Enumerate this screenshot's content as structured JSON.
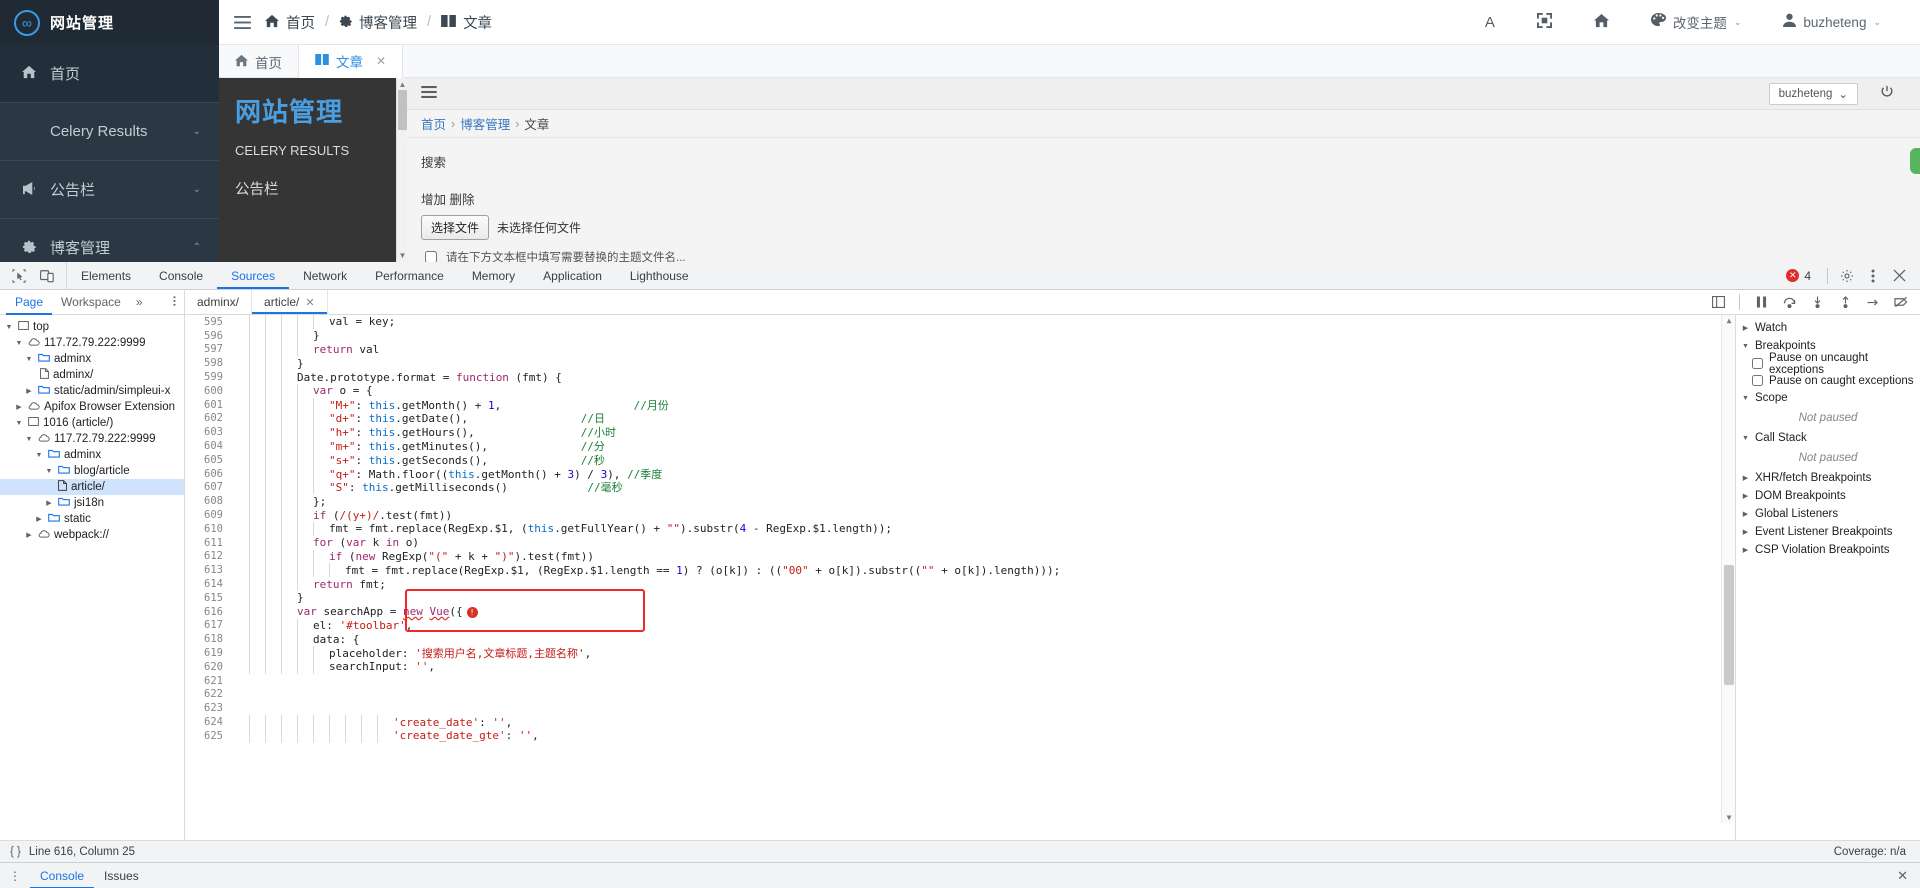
{
  "app": {
    "sidebar": {
      "logo_icon": "infinity-icon",
      "logo_text": "网站管理",
      "items": [
        {
          "icon": "home-icon",
          "label": "首页",
          "caret": "",
          "active": true
        },
        {
          "icon": "",
          "label": "Celery Results",
          "caret": "⌄",
          "active": false
        },
        {
          "icon": "megaphone-icon",
          "label": "公告栏",
          "caret": "⌄",
          "active": false
        },
        {
          "icon": "gear-icon",
          "label": "博客管理",
          "caret": "⌃",
          "active": false
        }
      ]
    },
    "header": {
      "hamburger_icon": "hamburger-icon",
      "breadcrumb": [
        {
          "icon": "home-icon",
          "label": "首页"
        },
        {
          "icon": "gear-icon",
          "label": "博客管理"
        },
        {
          "icon": "book-icon",
          "label": "文章"
        }
      ],
      "separator": "/",
      "actions": [
        {
          "icon": "font-size-icon",
          "glyph": "A",
          "label": ""
        },
        {
          "icon": "fullscreen-icon",
          "glyph": "⤢",
          "label": ""
        },
        {
          "icon": "home-icon",
          "glyph": "⌂",
          "label": ""
        },
        {
          "icon": "palette-icon",
          "glyph": "◕",
          "label": "改变主题",
          "caret": "⌄"
        },
        {
          "icon": "user-icon",
          "glyph": "👤",
          "label": "buzheteng",
          "caret": "⌄"
        }
      ]
    },
    "tabs": [
      {
        "icon": "home-icon",
        "label": "首页",
        "active": false,
        "closable": false
      },
      {
        "icon": "book-icon",
        "label": "文章",
        "active": true,
        "closable": true,
        "close": "✕"
      }
    ],
    "iframe": {
      "dark_panel": {
        "title": "网站管理",
        "items": [
          "CELERY RESULTS",
          "公告栏"
        ]
      },
      "burger_icon": "hamburger-icon",
      "user_label": "buzheteng",
      "user_caret": "⌄",
      "power_icon": "power-icon",
      "breadcrumb": [
        "首页",
        "博客管理",
        "文章"
      ],
      "breadcrumb_sep": "›",
      "search_label": "搜索",
      "actions": "增加 删除",
      "file_button": "选择文件",
      "file_status": "未选择任何文件",
      "check_hint": "请在下方文本框中填写需要替换的主题文件名..."
    }
  },
  "devtools": {
    "panel_tabs": [
      "Elements",
      "Console",
      "Sources",
      "Network",
      "Performance",
      "Memory",
      "Application",
      "Lighthouse"
    ],
    "active_panel": "Sources",
    "inspect_icon": "inspect-element-icon",
    "device_icon": "device-toolbar-icon",
    "error_count": "4",
    "error_icon": "error-badge-icon",
    "settings_icon": "gear-icon",
    "kebab_icon": "kebab-menu-icon",
    "close_icon": "close-icon",
    "navigator_tabs": [
      "Page",
      "Workspace"
    ],
    "navigator_more": "»",
    "navigator_active": "Page",
    "file_tabs": [
      {
        "label": "adminx/",
        "active": false,
        "close": ""
      },
      {
        "label": "article/",
        "active": true,
        "close": "✕"
      }
    ],
    "tree": [
      {
        "indent": 0,
        "tw": "▼",
        "icon": "frame-icon",
        "label": "top",
        "selected": false
      },
      {
        "indent": 1,
        "tw": "▼",
        "icon": "cloud-icon",
        "label": "117.72.79.222:9999",
        "selected": false
      },
      {
        "indent": 2,
        "tw": "▼",
        "icon": "folder-icon",
        "label": "adminx",
        "selected": false
      },
      {
        "indent": 3,
        "tw": "",
        "icon": "file-icon",
        "label": "adminx/",
        "selected": false
      },
      {
        "indent": 2,
        "tw": "▶",
        "icon": "folder-icon",
        "label": "static/admin/simpleui-x",
        "selected": false
      },
      {
        "indent": 1,
        "tw": "▶",
        "icon": "cloud-icon",
        "label": "Apifox Browser Extension",
        "selected": false
      },
      {
        "indent": 1,
        "tw": "▼",
        "icon": "frame-icon",
        "label": "1016 (article/)",
        "selected": false
      },
      {
        "indent": 2,
        "tw": "▼",
        "icon": "cloud-icon",
        "label": "117.72.79.222:9999",
        "selected": false
      },
      {
        "indent": 3,
        "tw": "▼",
        "icon": "folder-icon",
        "label": "adminx",
        "selected": false
      },
      {
        "indent": 4,
        "tw": "▼",
        "icon": "folder-icon",
        "label": "blog/article",
        "selected": false
      },
      {
        "indent": 5,
        "tw": "",
        "icon": "file-icon",
        "label": "article/",
        "selected": true
      },
      {
        "indent": 4,
        "tw": "▶",
        "icon": "folder-icon",
        "label": "jsi18n",
        "selected": false
      },
      {
        "indent": 3,
        "tw": "▶",
        "icon": "folder-icon",
        "label": "static",
        "selected": false
      },
      {
        "indent": 2,
        "tw": "▶",
        "icon": "cloud-icon",
        "label": "webpack://",
        "selected": false
      }
    ],
    "debug": {
      "watch": "Watch",
      "breakpoints": "Breakpoints",
      "pause_uncaught": "Pause on uncaught exceptions",
      "pause_caught": "Pause on caught exceptions",
      "scope": "Scope",
      "scope_note": "Not paused",
      "callstack": "Call Stack",
      "callstack_note": "Not paused",
      "sections": [
        "XHR/fetch Breakpoints",
        "DOM Breakpoints",
        "Global Listeners",
        "Event Listener Breakpoints",
        "CSP Violation Breakpoints"
      ]
    },
    "status": {
      "format_icon": "pretty-print-icon",
      "cursor": "Line 616, Column 25",
      "coverage": "Coverage: n/a"
    },
    "drawer": {
      "kebab": "⋮",
      "tabs": [
        "Console",
        "Issues"
      ],
      "active": "Console",
      "close": "✕"
    }
  },
  "code": {
    "first_line": 595,
    "lines": [
      {
        "n": 595,
        "indent": 5,
        "tokens": [
          {
            "t": "val = key;",
            "c": "plain"
          }
        ]
      },
      {
        "n": 596,
        "indent": 4,
        "tokens": [
          {
            "t": "}",
            "c": "plain"
          }
        ]
      },
      {
        "n": 597,
        "indent": 4,
        "tokens": [
          {
            "t": "return",
            "c": "kw"
          },
          {
            "t": " val",
            "c": "plain"
          }
        ]
      },
      {
        "n": 598,
        "indent": 3,
        "tokens": [
          {
            "t": "}",
            "c": "plain"
          }
        ]
      },
      {
        "n": 599,
        "indent": 3,
        "tokens": [
          {
            "t": "Date.prototype.format = ",
            "c": "plain"
          },
          {
            "t": "function",
            "c": "kw"
          },
          {
            "t": " (fmt) {",
            "c": "plain"
          }
        ]
      },
      {
        "n": 600,
        "indent": 4,
        "tokens": [
          {
            "t": "var",
            "c": "kw"
          },
          {
            "t": " o = {",
            "c": "plain"
          }
        ]
      },
      {
        "n": 601,
        "indent": 5,
        "tokens": [
          {
            "t": "\"M+\"",
            "c": "str"
          },
          {
            "t": ": ",
            "c": "plain"
          },
          {
            "t": "this",
            "c": "this"
          },
          {
            "t": ".getMonth() + ",
            "c": "plain"
          },
          {
            "t": "1",
            "c": "num"
          },
          {
            "t": ",",
            "c": "plain"
          },
          {
            "t": "                    ",
            "c": "plain"
          },
          {
            "t": "//月份",
            "c": "com"
          }
        ]
      },
      {
        "n": 602,
        "indent": 5,
        "tokens": [
          {
            "t": "\"d+\"",
            "c": "str"
          },
          {
            "t": ": ",
            "c": "plain"
          },
          {
            "t": "this",
            "c": "this"
          },
          {
            "t": ".getDate(),",
            "c": "plain"
          },
          {
            "t": "                 ",
            "c": "plain"
          },
          {
            "t": "//日",
            "c": "com"
          }
        ]
      },
      {
        "n": 603,
        "indent": 5,
        "tokens": [
          {
            "t": "\"h+\"",
            "c": "str"
          },
          {
            "t": ": ",
            "c": "plain"
          },
          {
            "t": "this",
            "c": "this"
          },
          {
            "t": ".getHours(),",
            "c": "plain"
          },
          {
            "t": "                ",
            "c": "plain"
          },
          {
            "t": "//小时",
            "c": "com"
          }
        ]
      },
      {
        "n": 604,
        "indent": 5,
        "tokens": [
          {
            "t": "\"m+\"",
            "c": "str"
          },
          {
            "t": ": ",
            "c": "plain"
          },
          {
            "t": "this",
            "c": "this"
          },
          {
            "t": ".getMinutes(),",
            "c": "plain"
          },
          {
            "t": "              ",
            "c": "plain"
          },
          {
            "t": "//分",
            "c": "com"
          }
        ]
      },
      {
        "n": 605,
        "indent": 5,
        "tokens": [
          {
            "t": "\"s+\"",
            "c": "str"
          },
          {
            "t": ": ",
            "c": "plain"
          },
          {
            "t": "this",
            "c": "this"
          },
          {
            "t": ".getSeconds(),",
            "c": "plain"
          },
          {
            "t": "              ",
            "c": "plain"
          },
          {
            "t": "//秒",
            "c": "com"
          }
        ]
      },
      {
        "n": 606,
        "indent": 5,
        "tokens": [
          {
            "t": "\"q+\"",
            "c": "str"
          },
          {
            "t": ": Math.floor((",
            "c": "plain"
          },
          {
            "t": "this",
            "c": "this"
          },
          {
            "t": ".getMonth() + ",
            "c": "plain"
          },
          {
            "t": "3",
            "c": "num"
          },
          {
            "t": ") / ",
            "c": "plain"
          },
          {
            "t": "3",
            "c": "num"
          },
          {
            "t": "), ",
            "c": "plain"
          },
          {
            "t": "//季度",
            "c": "com"
          }
        ]
      },
      {
        "n": 607,
        "indent": 5,
        "tokens": [
          {
            "t": "\"S\"",
            "c": "str"
          },
          {
            "t": ": ",
            "c": "plain"
          },
          {
            "t": "this",
            "c": "this"
          },
          {
            "t": ".getMilliseconds()",
            "c": "plain"
          },
          {
            "t": "            ",
            "c": "plain"
          },
          {
            "t": "//毫秒",
            "c": "com"
          }
        ]
      },
      {
        "n": 608,
        "indent": 4,
        "tokens": [
          {
            "t": "};",
            "c": "plain"
          }
        ]
      },
      {
        "n": 609,
        "indent": 4,
        "tokens": [
          {
            "t": "if",
            "c": "kw"
          },
          {
            "t": " (",
            "c": "plain"
          },
          {
            "t": "/(y+)/",
            "c": "str"
          },
          {
            "t": ".test(fmt))",
            "c": "plain"
          }
        ]
      },
      {
        "n": 610,
        "indent": 5,
        "tokens": [
          {
            "t": "fmt = fmt.replace(RegExp.$1, (",
            "c": "plain"
          },
          {
            "t": "this",
            "c": "this"
          },
          {
            "t": ".getFullYear() + ",
            "c": "plain"
          },
          {
            "t": "\"\"",
            "c": "str"
          },
          {
            "t": ").substr(",
            "c": "plain"
          },
          {
            "t": "4",
            "c": "num"
          },
          {
            "t": " - RegExp.$1.length));",
            "c": "plain"
          }
        ]
      },
      {
        "n": 611,
        "indent": 4,
        "tokens": [
          {
            "t": "for",
            "c": "kw"
          },
          {
            "t": " (",
            "c": "plain"
          },
          {
            "t": "var",
            "c": "kw"
          },
          {
            "t": " k ",
            "c": "plain"
          },
          {
            "t": "in",
            "c": "kw"
          },
          {
            "t": " o)",
            "c": "plain"
          }
        ]
      },
      {
        "n": 612,
        "indent": 5,
        "tokens": [
          {
            "t": "if",
            "c": "kw"
          },
          {
            "t": " (",
            "c": "plain"
          },
          {
            "t": "new",
            "c": "kw"
          },
          {
            "t": " RegExp(",
            "c": "plain"
          },
          {
            "t": "\"(\"",
            "c": "str"
          },
          {
            "t": " + k + ",
            "c": "plain"
          },
          {
            "t": "\")\"",
            "c": "str"
          },
          {
            "t": ").test(fmt))",
            "c": "plain"
          }
        ]
      },
      {
        "n": 613,
        "indent": 6,
        "tokens": [
          {
            "t": "fmt = fmt.replace(RegExp.$1, (RegExp.$1.length == ",
            "c": "plain"
          },
          {
            "t": "1",
            "c": "num"
          },
          {
            "t": ") ? (o[k]) : ((",
            "c": "plain"
          },
          {
            "t": "\"00\"",
            "c": "str"
          },
          {
            "t": " + o[k]).substr((",
            "c": "plain"
          },
          {
            "t": "\"\"",
            "c": "str"
          },
          {
            "t": " + o[k]).length)));",
            "c": "plain"
          }
        ]
      },
      {
        "n": 614,
        "indent": 4,
        "tokens": [
          {
            "t": "return",
            "c": "kw"
          },
          {
            "t": " fmt;",
            "c": "plain"
          }
        ]
      },
      {
        "n": 615,
        "indent": 3,
        "tokens": [
          {
            "t": "}",
            "c": "plain"
          }
        ]
      },
      {
        "n": 616,
        "indent": 3,
        "tokens": [
          {
            "t": "var",
            "c": "kw"
          },
          {
            "t": " searchApp = ",
            "c": "plain"
          },
          {
            "t": "new",
            "c": "squig"
          },
          {
            "t": " ",
            "c": "plain"
          },
          {
            "t": "Vue",
            "c": "squig"
          },
          {
            "t": "({",
            "c": "plain"
          },
          {
            "t": "ERRBADGE",
            "c": "err"
          }
        ]
      },
      {
        "n": 617,
        "indent": 4,
        "tokens": [
          {
            "t": "el: ",
            "c": "plain"
          },
          {
            "t": "'#toolbar'",
            "c": "str"
          },
          {
            "t": ",",
            "c": "plain"
          }
        ]
      },
      {
        "n": 618,
        "indent": 4,
        "tokens": [
          {
            "t": "data: {",
            "c": "plain"
          }
        ]
      },
      {
        "n": 619,
        "indent": 5,
        "tokens": [
          {
            "t": "placeholder: ",
            "c": "plain"
          },
          {
            "t": "'搜索用户名,文章标题,主题名称'",
            "c": "str"
          },
          {
            "t": ",",
            "c": "plain"
          }
        ]
      },
      {
        "n": 620,
        "indent": 5,
        "tokens": [
          {
            "t": "searchInput: ",
            "c": "plain"
          },
          {
            "t": "''",
            "c": "str"
          },
          {
            "t": ",",
            "c": "plain"
          }
        ]
      },
      {
        "n": 621,
        "indent": 0,
        "tokens": []
      },
      {
        "n": 622,
        "indent": 0,
        "tokens": []
      },
      {
        "n": 623,
        "indent": 0,
        "tokens": []
      },
      {
        "n": 624,
        "indent": 9,
        "tokens": [
          {
            "t": "'create_date'",
            "c": "str"
          },
          {
            "t": ": ",
            "c": "plain"
          },
          {
            "t": "''",
            "c": "str"
          },
          {
            "t": ",",
            "c": "plain"
          }
        ]
      },
      {
        "n": 625,
        "indent": 9,
        "tokens": [
          {
            "t": "'create_date_gte'",
            "c": "str"
          },
          {
            "t": ": ",
            "c": "plain"
          },
          {
            "t": "''",
            "c": "str"
          },
          {
            "t": ",",
            "c": "plain"
          }
        ]
      }
    ]
  }
}
